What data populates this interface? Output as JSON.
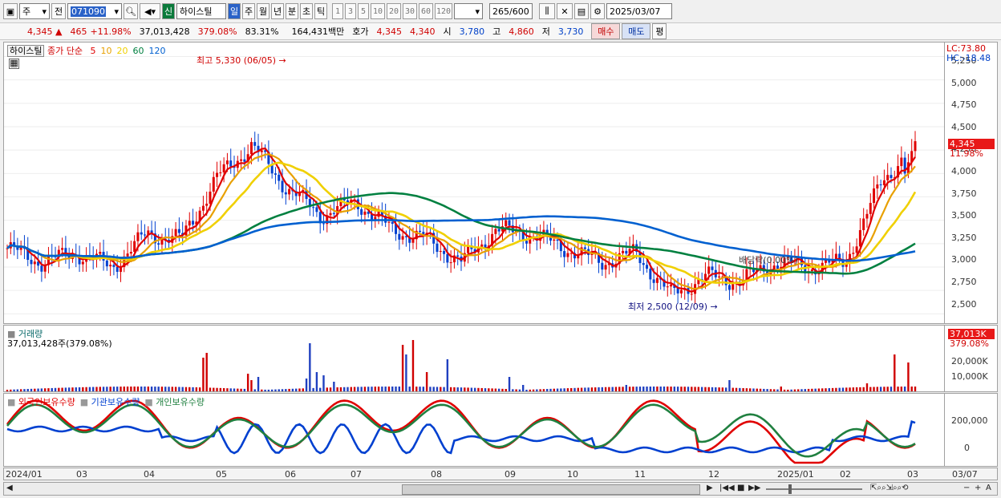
{
  "toolbar": {
    "market": "주",
    "prev_label": "전",
    "code": "071090",
    "new_badge": "신",
    "stock_name": "하이스틸",
    "periods": [
      "일",
      "주",
      "월",
      "년",
      "분",
      "초",
      "틱"
    ],
    "active_period": "일",
    "intervals": [
      "1",
      "3",
      "5",
      "10",
      "20",
      "30",
      "60",
      "120"
    ],
    "count_current": "265",
    "count_total": "600",
    "date": "2025/03/07"
  },
  "info": {
    "price": "4,345",
    "change": "465",
    "change_pct": "+11.98%",
    "volume": "37,013,428",
    "volume_ratio": "379.08%",
    "turnover_pct": "83.31%",
    "amount": "164,431백만",
    "ask_label": "호가",
    "ask1": "4,345",
    "ask2": "4,340",
    "open_label": "시",
    "open": "3,780",
    "high_label": "고",
    "high": "4,860",
    "low_label": "저",
    "low": "3,730",
    "buy_btn": "매수",
    "sell_btn": "매도",
    "eval_btn": "평"
  },
  "price_panel": {
    "legend_name": "하이스틸",
    "legend_ma_label": "종가 단순",
    "ma_periods": [
      "5",
      "10",
      "20",
      "60",
      "120"
    ],
    "ma_colors": [
      "#e00000",
      "#e8a000",
      "#f0d000",
      "#008040",
      "#0060d0"
    ],
    "high_annot": "최고 5,330 (06/05)",
    "low_annot": "최저 2,500 (12/09)",
    "dividend_annot": "배당락(0.00%)",
    "lc_label": "LC:73.80",
    "hc_label": "HC:-18.48",
    "last_tag": "4,345",
    "last_pct": "11.98%",
    "yticks": [
      "5,250",
      "5,000",
      "4,750",
      "4,500",
      "4,250",
      "4,000",
      "3,750",
      "3,500",
      "3,250",
      "3,000",
      "2,750",
      "2,500"
    ]
  },
  "volume_panel": {
    "title": "거래량",
    "subtitle": "37,013,428주(379.08%)",
    "tag": "37,013K",
    "tag_pct": "379.08%",
    "yticks": [
      "20,000K",
      "10,000K"
    ]
  },
  "holding_panel": {
    "series_names": [
      "외국인보유수량",
      "기관보유수량",
      "개인보유수량"
    ],
    "series_colors": [
      "#e00000",
      "#0040d0",
      "#208040"
    ],
    "yticks": [
      "200,000",
      "0"
    ]
  },
  "dates": [
    "2024/01",
    "03",
    "04",
    "05",
    "06",
    "07",
    "08",
    "09",
    "10",
    "11",
    "12",
    "2025/01",
    "02",
    "03"
  ],
  "axis_date": "03/07",
  "chart_data": {
    "type": "candlestick",
    "title": "하이스틸",
    "x_range": [
      "2024/01",
      "2025/03/07"
    ],
    "ylim": [
      2400,
      5400
    ],
    "close_series": [
      {
        "x": "2024/01",
        "y": 3200
      },
      {
        "x": "2024/02",
        "y": 3050
      },
      {
        "x": "2024/03",
        "y": 3150
      },
      {
        "x": "2024/04",
        "y": 3000
      },
      {
        "x": "2024/04b",
        "y": 3350
      },
      {
        "x": "2024/05",
        "y": 3300
      },
      {
        "x": "2024/05b",
        "y": 3950
      },
      {
        "x": "2024/06",
        "y": 4300
      },
      {
        "x": "2024/06b",
        "y": 3850
      },
      {
        "x": "2024/07",
        "y": 3550
      },
      {
        "x": "2024/07b",
        "y": 3700
      },
      {
        "x": "2024/08",
        "y": 3400
      },
      {
        "x": "2024/08b",
        "y": 3300
      },
      {
        "x": "2024/09",
        "y": 3050
      },
      {
        "x": "2024/09b",
        "y": 3400
      },
      {
        "x": "2024/10",
        "y": 3350
      },
      {
        "x": "2024/10b",
        "y": 3200
      },
      {
        "x": "2024/11",
        "y": 3050
      },
      {
        "x": "2024/11b",
        "y": 3150
      },
      {
        "x": "2024/12",
        "y": 2700
      },
      {
        "x": "2024/12b",
        "y": 2900
      },
      {
        "x": "2025/01",
        "y": 2850
      },
      {
        "x": "2025/01b",
        "y": 3050
      },
      {
        "x": "2025/02",
        "y": 3000
      },
      {
        "x": "2025/02b",
        "y": 3050
      },
      {
        "x": "2025/03",
        "y": 3880
      },
      {
        "x": "2025/03/07",
        "y": 4345
      }
    ]
  }
}
